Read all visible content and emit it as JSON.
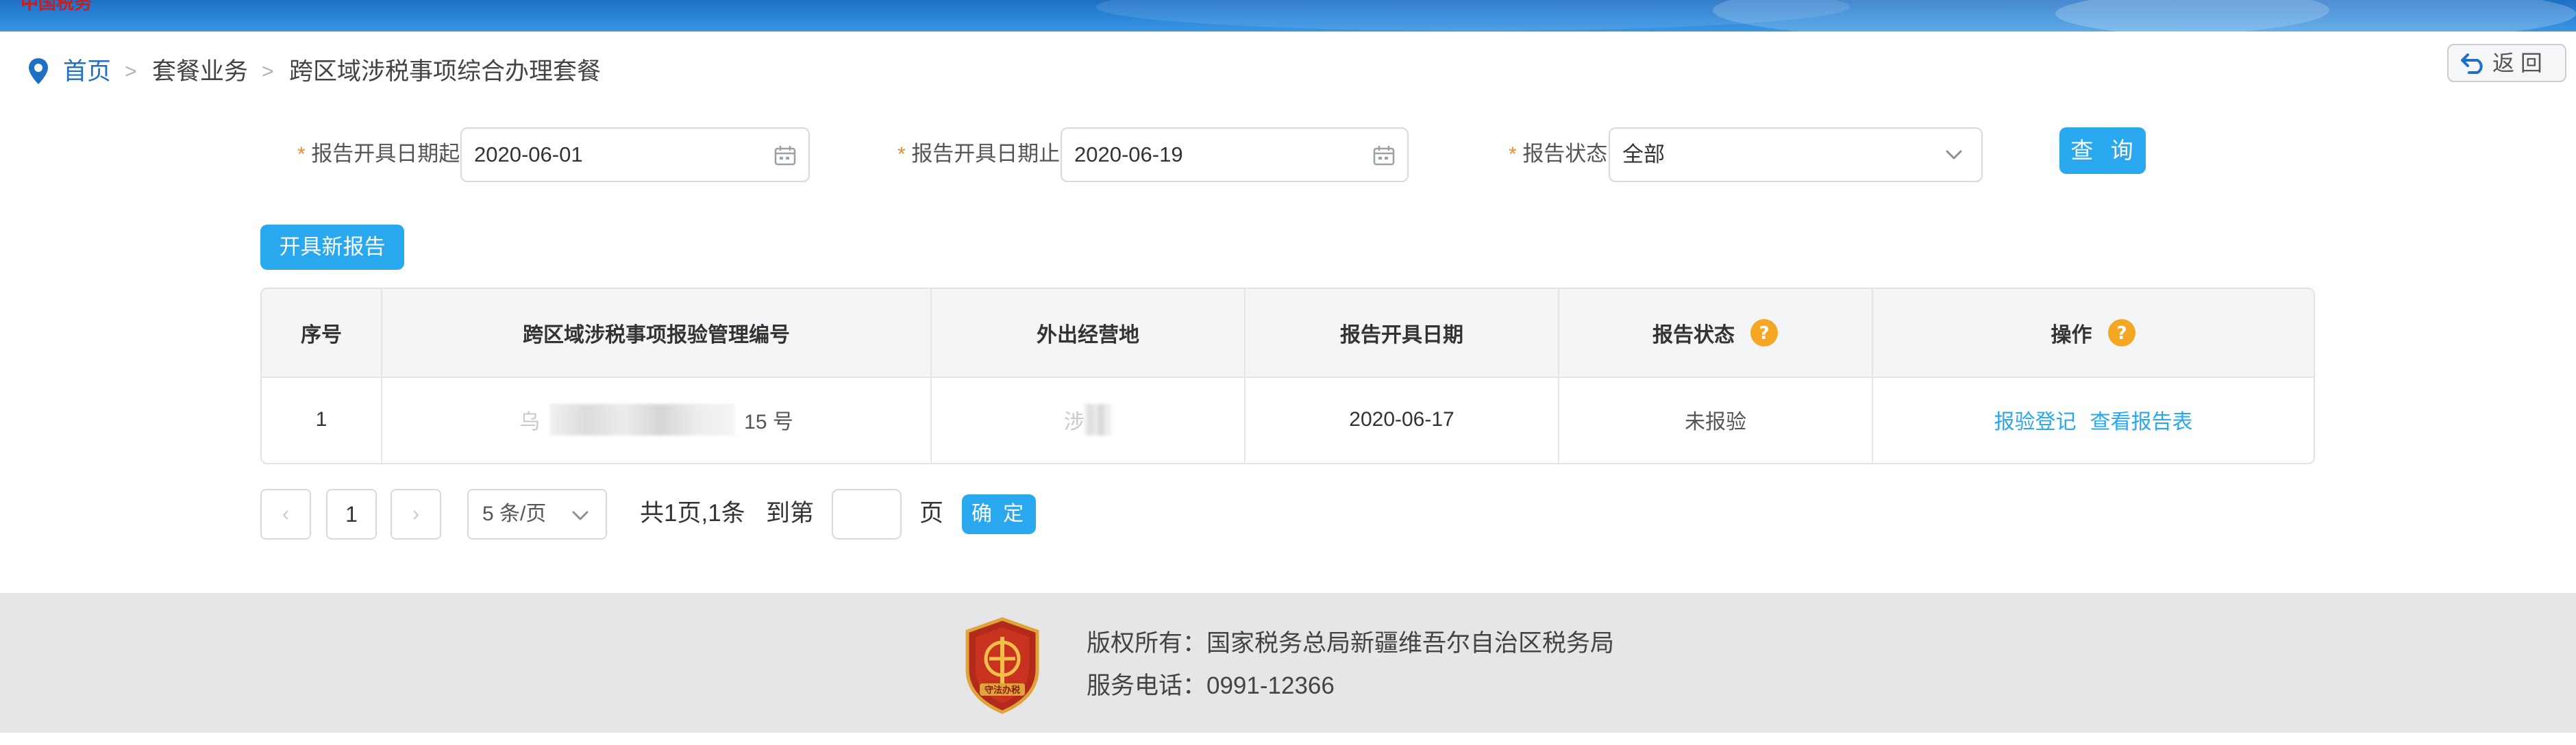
{
  "banner": {
    "logo_text": "中国税务",
    "colors": {
      "top": "#1f6fc4",
      "bottom": "#3a96e2"
    }
  },
  "breadcrumb": {
    "home": "首页",
    "separator": ">",
    "level2": "套餐业务",
    "current": "跨区域涉税事项综合办理套餐"
  },
  "back_button": {
    "icon": "return-arrow-icon",
    "label": "返 回"
  },
  "filters": {
    "required_mark": "*",
    "date_from": {
      "label": "报告开具日期起",
      "value": "2020-06-01",
      "icon": "calendar-icon"
    },
    "date_to": {
      "label": "报告开具日期止",
      "value": "2020-06-19",
      "icon": "calendar-icon"
    },
    "status": {
      "label": "报告状态",
      "value": "全部",
      "icon": "chevron-down-icon"
    },
    "query_label": "查 询"
  },
  "new_report_button": "开具新报告",
  "table": {
    "headers": [
      "序号",
      "跨区域涉税事项报验管理编号",
      "外出经营地",
      "报告开具日期",
      "报告状态",
      "操作"
    ],
    "help_icon": "question-icon",
    "rows": [
      {
        "index": "1",
        "code_prefix": "乌",
        "code_suffix": "15 号",
        "location_prefix": "涉",
        "date": "2020-06-17",
        "status": "未报验",
        "actions": [
          "报验登记",
          "查看报告表"
        ]
      }
    ]
  },
  "pagination": {
    "prev": "‹",
    "current_page": "1",
    "next": "›",
    "page_size": "5 条/页",
    "summary": "共1页,1条",
    "goto_label": "到第",
    "page_unit": "页",
    "confirm_label": "确 定"
  },
  "footer": {
    "badge_icon": "tax-bureau-badge-icon",
    "badge_text": "守法办税",
    "copyright": "版权所有：国家税务总局新疆维吾尔自治区税务局",
    "phone": "服务电话：0991-12366"
  },
  "colors": {
    "accent": "#29a7ef",
    "link": "#1f6fc4",
    "required": "#f08d2e",
    "help": "#f5a623",
    "footer_bg": "#e6e6e8"
  }
}
